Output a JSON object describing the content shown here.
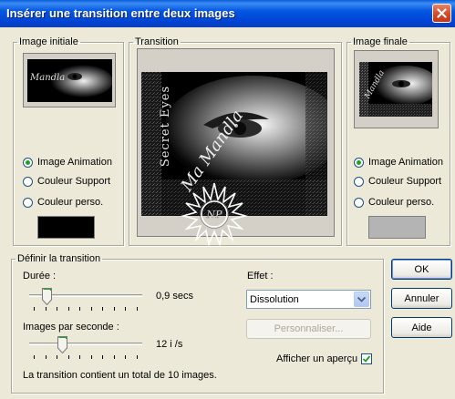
{
  "window": {
    "title": "Insérer une transition entre deux images"
  },
  "initial": {
    "legend": "Image initiale",
    "options": [
      "Image Animation",
      "Couleur Support",
      "Couleur perso."
    ],
    "selected": 0,
    "swatch_color": "#000000",
    "thumb_text": "Mandla"
  },
  "transition": {
    "legend": "Transition",
    "side_text": "Secret Eyes",
    "script_text": "Ma Mandla",
    "watermark_text": "NP"
  },
  "final": {
    "legend": "Image finale",
    "options": [
      "Image Animation",
      "Couleur Support",
      "Couleur perso."
    ],
    "selected": 0,
    "swatch_color": "#b4b4b4",
    "thumb_text": "Mandla"
  },
  "define": {
    "legend": "Définir la transition",
    "duration_label": "Durée :",
    "duration_value": "0,9 secs",
    "duration_level": 0.12,
    "fps_label": "Images par seconde :",
    "fps_value": "12 i /s",
    "fps_level": 0.27,
    "effect_label": "Effet :",
    "effect_value": "Dissolution",
    "customize_label": "Personnaliser...",
    "preview_label": "Afficher un aperçu",
    "preview_checked": true,
    "summary": "La transition contient un total de 10 images."
  },
  "buttons": {
    "ok": "OK",
    "cancel": "Annuler",
    "help": "Aide"
  }
}
